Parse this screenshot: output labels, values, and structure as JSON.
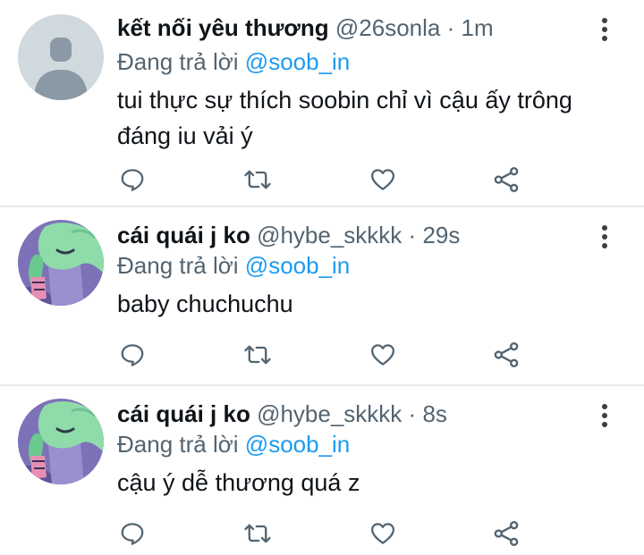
{
  "tweets": [
    {
      "display_name": "kết nối yêu thương",
      "handle": "@26sonla",
      "separator": "·",
      "time": "1m",
      "replying_prefix": "Đang trả lời",
      "replying_to": "@soob_in",
      "text": "tui thực sự thích soobin chỉ vì cậu ấy trông đáng iu vải ý",
      "avatar_icon": "default-profile-icon"
    },
    {
      "display_name": "cái quái j ko",
      "handle": "@hybe_skkkk",
      "separator": "·",
      "time": "29s",
      "replying_prefix": "Đang trả lời",
      "replying_to": "@soob_in",
      "text": "baby chuchuchu",
      "avatar_icon": "cartoon-avatar"
    },
    {
      "display_name": "cái quái j ko",
      "handle": "@hybe_skkkk",
      "separator": "·",
      "time": "8s",
      "replying_prefix": "Đang trả lời",
      "replying_to": "@soob_in",
      "text": "cậu ý dễ thương quá z",
      "avatar_icon": "cartoon-avatar"
    }
  ],
  "icons": {
    "reply": "reply-icon",
    "retweet": "retweet-icon",
    "like": "heart-icon",
    "share": "share-icon",
    "more": "more-options-icon"
  },
  "colors": {
    "link": "#1d9bf0",
    "secondary_text": "#536471",
    "icon": "#536471",
    "divider": "#e6e9ec",
    "default_avatar_bg": "#cfd9de",
    "default_avatar_fg": "#8b98a5"
  }
}
